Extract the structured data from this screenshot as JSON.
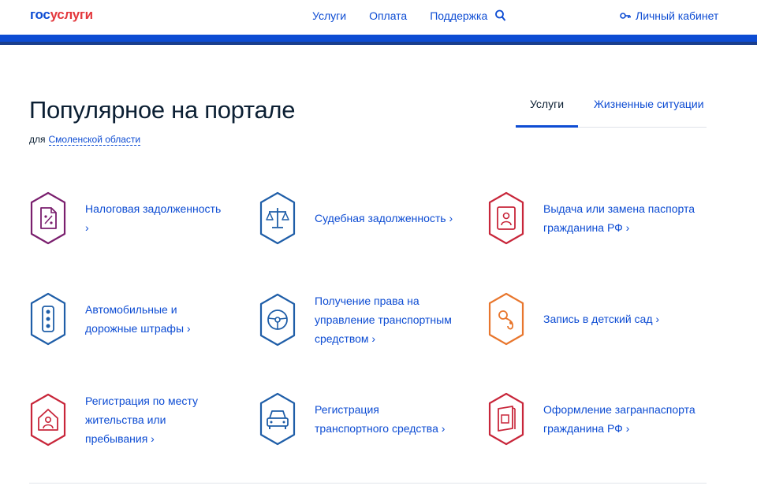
{
  "header": {
    "logo_part1": "гос",
    "logo_part2": "услуги",
    "nav": [
      "Услуги",
      "Оплата",
      "Поддержка"
    ],
    "cabinet_label": "Личный кабинет"
  },
  "main": {
    "title": "Популярное на портале",
    "region_prefix": "для",
    "region_link": "Смоленской области",
    "tabs": [
      {
        "label": "Услуги",
        "active": true
      },
      {
        "label": "Жизненные ситуации",
        "active": false
      }
    ]
  },
  "services": [
    {
      "label": "Налоговая задолженность ›",
      "icon": "tax-document-icon",
      "color": "#7a1f6e"
    },
    {
      "label": "Судебная задолженность ›",
      "icon": "scales-icon",
      "color": "#1f5ea8"
    },
    {
      "label": "Выдача или замена паспорта гражданина РФ ›",
      "icon": "passport-icon",
      "color": "#c8263a"
    },
    {
      "label": "Автомобильные и дорожные штрафы ›",
      "icon": "traffic-light-icon",
      "color": "#1f5ea8"
    },
    {
      "label": "Получение права на управление транспортным средством ›",
      "icon": "steering-wheel-icon",
      "color": "#1f5ea8"
    },
    {
      "label": "Запись в детский сад ›",
      "icon": "pacifier-icon",
      "color": "#e8762d"
    },
    {
      "label": "Регистрация по месту жительства или пребывания ›",
      "icon": "house-person-icon",
      "color": "#c8263a"
    },
    {
      "label": "Регистрация транспортного средства ›",
      "icon": "car-icon",
      "color": "#1f5ea8"
    },
    {
      "label": "Оформление загранпаспорта гражданина РФ ›",
      "icon": "foreign-passport-icon",
      "color": "#c8263a"
    }
  ]
}
